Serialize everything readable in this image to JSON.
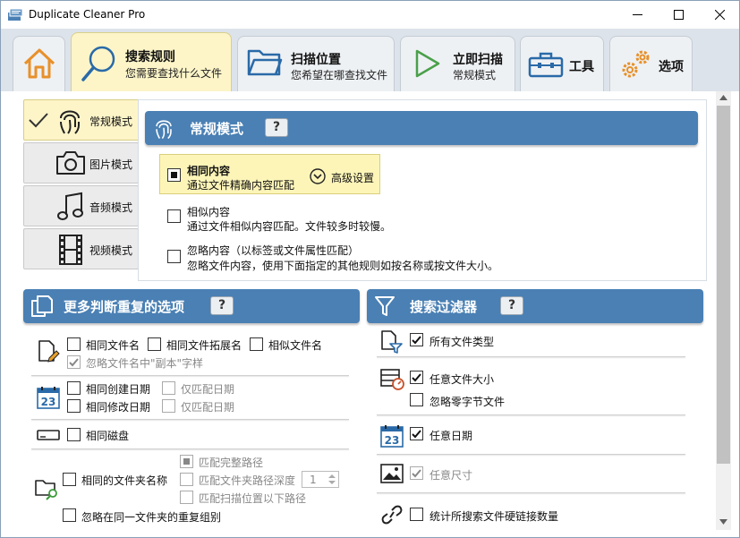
{
  "window": {
    "title": "Duplicate Cleaner Pro"
  },
  "tabs": [
    {
      "id": "home",
      "label": "",
      "sub": ""
    },
    {
      "id": "search",
      "label": "搜索规则",
      "sub": "您需要查找什么文件"
    },
    {
      "id": "location",
      "label": "扫描位置",
      "sub": "您希望在哪查找文件"
    },
    {
      "id": "scan",
      "label": "立即扫描",
      "sub": "常规模式"
    },
    {
      "id": "tools",
      "label": "工具",
      "sub": ""
    },
    {
      "id": "options",
      "label": "选项",
      "sub": ""
    }
  ],
  "modes": [
    "常规模式",
    "图片模式",
    "音频模式",
    "视频模式"
  ],
  "mode_panel": {
    "title": "常规模式",
    "help": "?",
    "options": [
      {
        "title": "相同内容",
        "desc": "通过文件精确内容匹配",
        "selected": true
      },
      {
        "title": "相似内容",
        "desc": "通过文件相似内容匹配。文件较多时较慢。",
        "selected": false
      },
      {
        "title": "忽略内容（以标签或文件属性匹配）",
        "desc": "忽略文件内容，使用下面指定的其他规则如按名称或按文件大小。",
        "selected": false
      }
    ],
    "advanced": "高级设置"
  },
  "more_options": {
    "title": "更多判断重复的选项",
    "help": "?",
    "same_name": "相同文件名",
    "same_ext": "相同文件拓展名",
    "similar_name": "相似文件名",
    "ignore_copy": "忽略文件名中\"副本\"字样",
    "same_created": "相同创建日期",
    "date_only_1": "仅匹配日期",
    "same_modified": "相同修改日期",
    "date_only_2": "仅匹配日期",
    "same_disk": "相同磁盘",
    "same_folder": "相同的文件夹名称",
    "full_path": "匹配完整路径",
    "folder_depth": "匹配文件夹路径深度",
    "depth_value": "1",
    "below_path": "匹配扫描位置以下路径",
    "ignore_same_folder": "忽略在同一文件夹的重复组别"
  },
  "filters": {
    "title": "搜索过滤器",
    "help": "?",
    "all_types": "所有文件类型",
    "any_size": "任意文件大小",
    "ignore_zero": "忽略零字节文件",
    "any_date": "任意日期",
    "any_dimension": "任意尺寸",
    "hardlinks": "统计所搜索文件硬链接数量"
  },
  "colors": {
    "accent": "#4a80b4",
    "active_tab": "#fdf5c8",
    "tab_bar": "#dde3ea"
  },
  "icons": [
    "fingerprint-icon",
    "camera-icon",
    "music-icon",
    "film-icon",
    "copy-icon",
    "funnel-icon",
    "document-icon",
    "calendar-icon",
    "disk-icon",
    "folder-search-icon",
    "filetype-filter-icon",
    "size-icon",
    "image-icon",
    "link-icon"
  ]
}
